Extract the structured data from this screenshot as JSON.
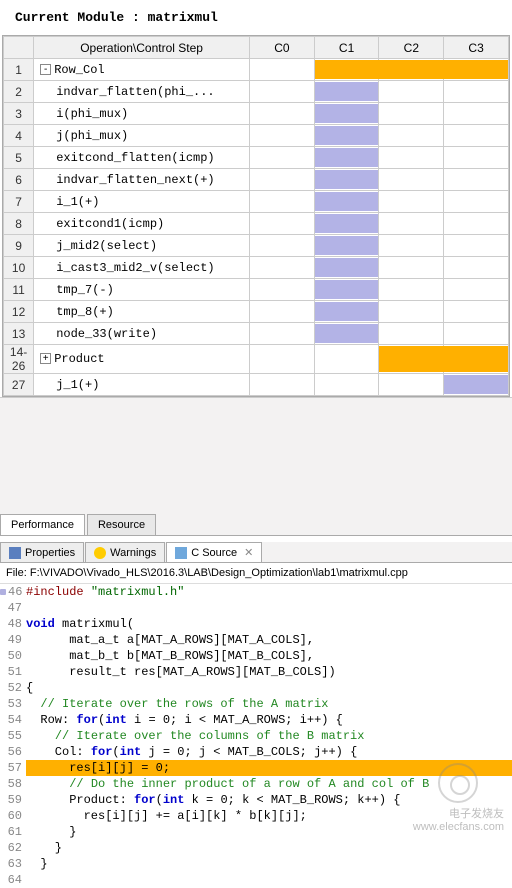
{
  "module_label": "Current Module : matrixmul",
  "headers": {
    "num": "",
    "op": "Operation\\Control Step",
    "c0": "C0",
    "c1": "C1",
    "c2": "C2",
    "c3": "C3"
  },
  "rows": [
    {
      "n": "1",
      "op": "Row_Col",
      "lv": 0,
      "exp": "-",
      "bars": [
        {
          "c": 1,
          "span": 3,
          "cls": "yellow"
        }
      ]
    },
    {
      "n": "2",
      "op": "indvar_flatten(phi_...",
      "lv": 1,
      "bars": [
        {
          "c": 1,
          "span": 1
        }
      ]
    },
    {
      "n": "3",
      "op": "i(phi_mux)",
      "lv": 1,
      "bars": [
        {
          "c": 1,
          "span": 1
        }
      ]
    },
    {
      "n": "4",
      "op": "j(phi_mux)",
      "lv": 1,
      "bars": [
        {
          "c": 1,
          "span": 1
        }
      ]
    },
    {
      "n": "5",
      "op": "exitcond_flatten(icmp)",
      "lv": 1,
      "bars": [
        {
          "c": 1,
          "span": 1
        }
      ]
    },
    {
      "n": "6",
      "op": "indvar_flatten_next(+)",
      "lv": 1,
      "bars": [
        {
          "c": 1,
          "span": 1
        }
      ]
    },
    {
      "n": "7",
      "op": "i_1(+)",
      "lv": 1,
      "bars": [
        {
          "c": 1,
          "span": 1
        }
      ]
    },
    {
      "n": "8",
      "op": "exitcond1(icmp)",
      "lv": 1,
      "bars": [
        {
          "c": 1,
          "span": 1
        }
      ]
    },
    {
      "n": "9",
      "op": "j_mid2(select)",
      "lv": 1,
      "bars": [
        {
          "c": 1,
          "span": 1
        }
      ]
    },
    {
      "n": "10",
      "op": "i_cast3_mid2_v(select)",
      "lv": 1,
      "bars": [
        {
          "c": 1,
          "span": 1
        }
      ]
    },
    {
      "n": "11",
      "op": "tmp_7(-)",
      "lv": 1,
      "bars": [
        {
          "c": 1,
          "span": 1
        }
      ]
    },
    {
      "n": "12",
      "op": "tmp_8(+)",
      "lv": 1,
      "bars": [
        {
          "c": 1,
          "span": 1
        }
      ]
    },
    {
      "n": "13",
      "op": "node_33(write)",
      "lv": 1,
      "bars": [
        {
          "c": 1,
          "span": 1
        }
      ]
    },
    {
      "n": "14-26",
      "op": "Product",
      "lv": 0,
      "exp": "+",
      "bars": [
        {
          "c": 2,
          "span": 2,
          "cls": "yellow"
        }
      ]
    },
    {
      "n": "27",
      "op": "j_1(+)",
      "lv": 1,
      "bars": [
        {
          "c": 3,
          "span": 1
        }
      ]
    }
  ],
  "lower_tabs": {
    "perf": "Performance",
    "res": "Resource"
  },
  "editor_tabs": {
    "prop": "Properties",
    "warn": "Warnings",
    "src": "C Source"
  },
  "file_label": "File:",
  "file_path": "F:\\VIVADO\\Vivado_HLS\\2016.3\\LAB\\Design_Optimization\\lab1\\matrixmul.cpp",
  "code": {
    "l46": "#include \"matrixmul.h\"",
    "l47": "",
    "l48": "void matrixmul(",
    "l49": "      mat_a_t a[MAT_A_ROWS][MAT_A_COLS],",
    "l50": "      mat_b_t b[MAT_B_ROWS][MAT_B_COLS],",
    "l51": "      result_t res[MAT_A_ROWS][MAT_B_COLS])",
    "l52": "{",
    "l53": "  // Iterate over the rows of the A matrix",
    "l54": "  Row: for(int i = 0; i < MAT_A_ROWS; i++) {",
    "l55": "    // Iterate over the columns of the B matrix",
    "l56": "    Col: for(int j = 0; j < MAT_B_COLS; j++) {",
    "l57": "      res[i][j] = 0;",
    "l58": "      // Do the inner product of a row of A and col of B",
    "l59": "      Product: for(int k = 0; k < MAT_B_ROWS; k++) {",
    "l60": "        res[i][j] += a[i][k] * b[k][j];",
    "l61": "      }",
    "l62": "    }",
    "l63": "  }",
    "l64": ""
  },
  "watermark": {
    "line1": "电子发烧友",
    "line2": "www.elecfans.com"
  }
}
